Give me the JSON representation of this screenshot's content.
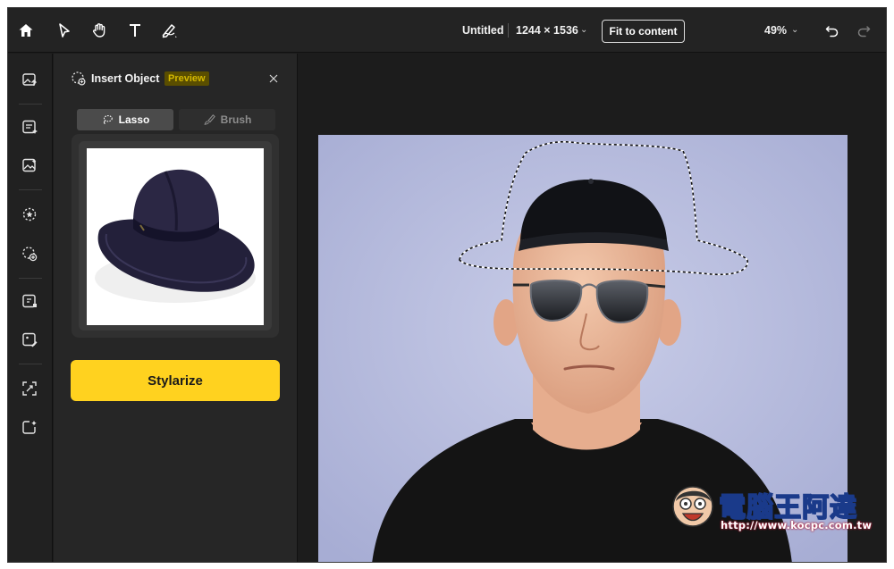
{
  "topbar": {
    "doc_title": "Untitled",
    "doc_size": "1244 × 1536",
    "fit_label": "Fit to content",
    "zoom": "49%",
    "icons": [
      "home-icon",
      "select-arrow-icon",
      "hand-icon",
      "text-tool-icon",
      "pen-tool-icon",
      "undo-icon",
      "redo-icon"
    ]
  },
  "rail": {
    "icons": [
      "image-upload-icon",
      "text-edit-icon",
      "image-edit-icon",
      "magic-select-icon",
      "insert-object-icon",
      "crop-expand-icon",
      "image-style-icon",
      "upscale-icon",
      "generate-icon"
    ]
  },
  "panel": {
    "title": "Insert Object",
    "badge": "Preview",
    "tabs": [
      {
        "label": "Lasso",
        "active": true
      },
      {
        "label": "Brush",
        "active": false
      }
    ],
    "action_label": "Stylarize"
  },
  "watermark": {
    "text": "電腦王阿達",
    "url": "http://www.kocpc.com.tw"
  },
  "colors": {
    "accent": "#ffd21f",
    "badge_bg": "#5a4e00",
    "badge_text": "#d4b800",
    "bg": "#1c1c1c"
  }
}
